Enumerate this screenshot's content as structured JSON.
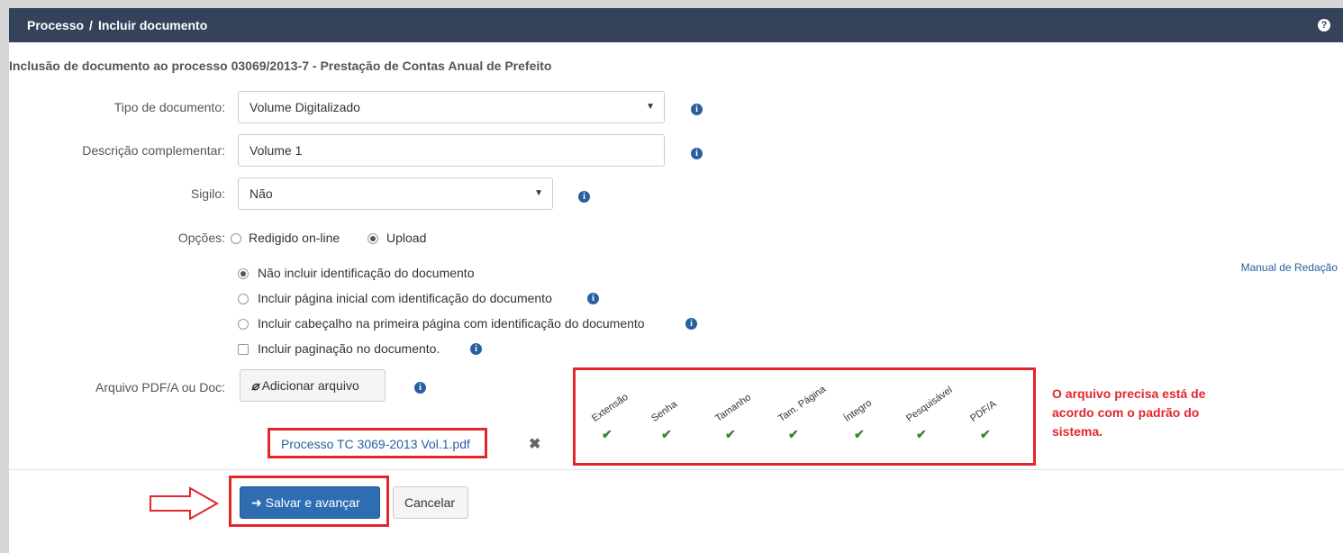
{
  "header": {
    "breadcrumb_root": "Processo",
    "breadcrumb_sep": "/",
    "breadcrumb_current": "Incluir documento",
    "help_glyph": "?"
  },
  "page": {
    "subtitle": "Inclusão de documento ao processo 03069/2013-7 - Prestação de Contas Anual de Prefeito"
  },
  "form": {
    "tipo": {
      "label": "Tipo de documento:",
      "value": "Volume Digitalizado"
    },
    "descricao": {
      "label": "Descrição complementar:",
      "value": "Volume 1"
    },
    "sigilo": {
      "label": "Sigilo:",
      "value": "Não"
    },
    "opcoes": {
      "label": "Opções:",
      "items": [
        {
          "label": "Redigido on-line",
          "checked": false
        },
        {
          "label": "Upload",
          "checked": true
        }
      ]
    },
    "identificacao": [
      {
        "label": "Não incluir identificação do documento",
        "checked": true
      },
      {
        "label": "Incluir página inicial com identificação do documento",
        "checked": false
      },
      {
        "label": "Incluir cabeçalho na primeira página com identificação do documento",
        "checked": false
      }
    ],
    "paginacao": {
      "label": "Incluir paginação no documento.",
      "checked": false
    },
    "manual_link": "Manual de Redação",
    "arquivo": {
      "label": "Arquivo PDF/A ou Doc:",
      "button": "Adicionar arquivo",
      "file_name": "Processo TC 3069-2013 Vol.1.pdf",
      "remove_glyph": "✖"
    }
  },
  "validation": {
    "checks": [
      "Extensão",
      "Senha",
      "Tamanho",
      "Tam. Página",
      "Íntegro",
      "Pesquisável",
      "PDF/A"
    ],
    "check_glyph": "✔",
    "note": "O arquivo precisa está de acordo com o padrão do sistema.",
    "accent_color": "#e3262b"
  },
  "actions": {
    "save": "Salvar e avançar",
    "cancel": "Cancelar"
  },
  "colors": {
    "header_bg": "#34435a",
    "primary": "#2f6db3",
    "link": "#2a5f9e",
    "check": "#2f8a2f"
  }
}
